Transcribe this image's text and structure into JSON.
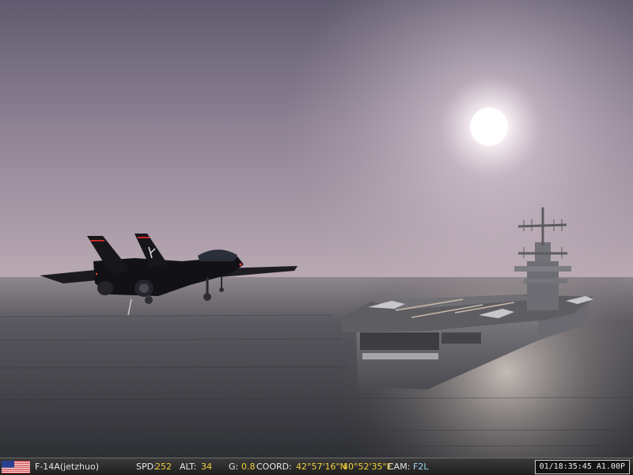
{
  "hud": {
    "aircraft": "F-14A(jetzhuo)",
    "speed_label": "SPD:",
    "speed_value": "252",
    "altitude_label": "ALT:",
    "altitude_value": "34",
    "g_label": "G:",
    "g_value": "0.8",
    "coord_label": "COORD:",
    "latitude": "42°57'16\"N",
    "longitude": "40°52'35\"E",
    "cam_label": "CAM:",
    "cam_value": "F2L",
    "clock": "01/18:35:45 A1.00P",
    "flag_icon": "us-flag-icon"
  },
  "colors": {
    "hud_value": "#f2cf3a",
    "hud_cam": "#9fd3f2",
    "sky_top": "#6a6479",
    "sea": "#3d3e44"
  }
}
